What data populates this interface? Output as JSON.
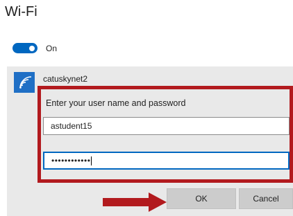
{
  "window": {
    "title": "Wi-Fi"
  },
  "wifi_toggle": {
    "state_label": "On",
    "is_on": true
  },
  "network": {
    "name": "catuskynet2"
  },
  "auth": {
    "prompt": "Enter your user name and password",
    "username_value": "astudent15",
    "password_value": "••••••••••••"
  },
  "buttons": {
    "ok_label": "OK",
    "cancel_label": "Cancel"
  },
  "annotation": {
    "color": "#b21a1e"
  },
  "icons": {
    "network": "wifi-signal-icon",
    "pointer": "arrow-right-icon"
  },
  "colors": {
    "accent": "#0067c0",
    "tile": "#1f6fc5",
    "panel": "#e9e9e9"
  }
}
